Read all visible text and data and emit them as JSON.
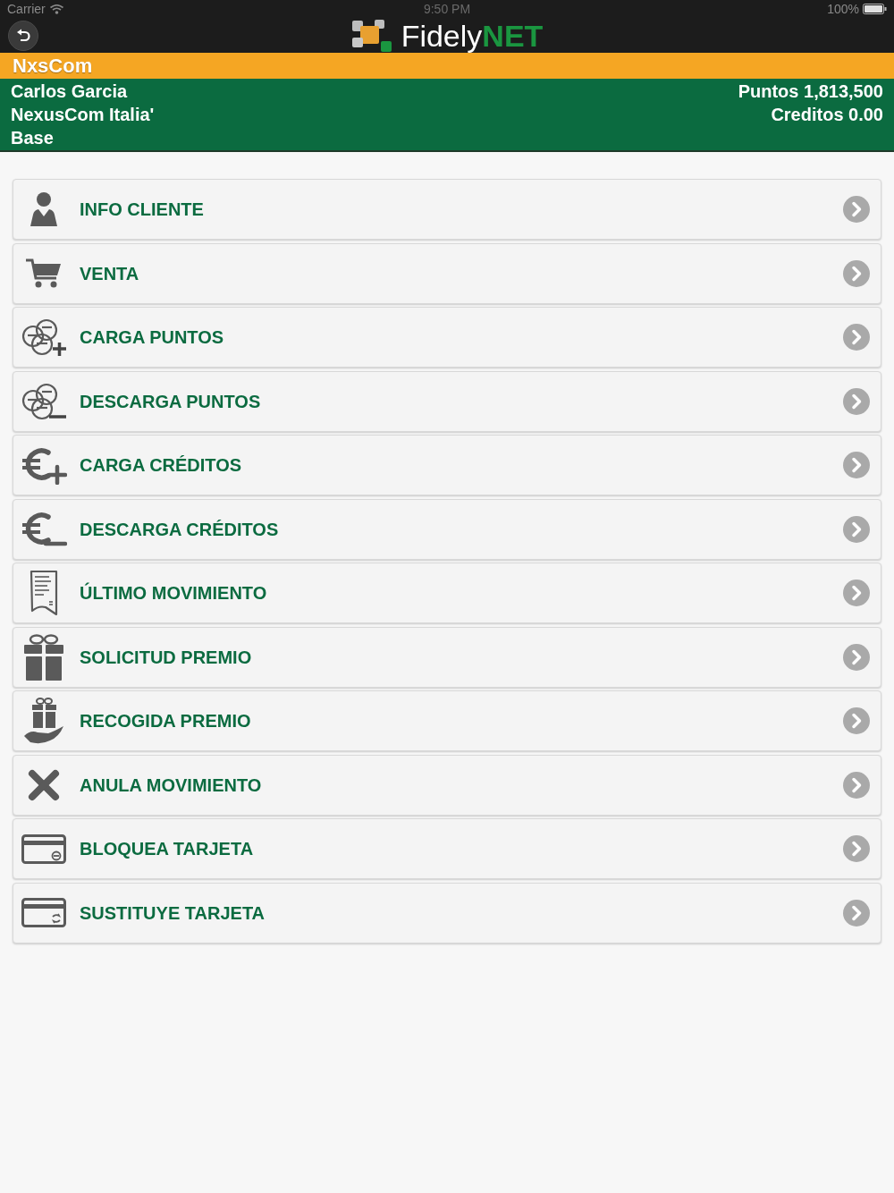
{
  "status_bar": {
    "carrier": "Carrier",
    "time": "9:50 PM",
    "battery": "100%"
  },
  "nav_bar": {
    "logo": "Fidely**NET**"
  },
  "store_bar": {
    "name": "NxsCom"
  },
  "customer": {
    "name": "Carlos Garcia",
    "company": "NexusCom Italia'",
    "tier": "Base",
    "points": "Puntos 1,813,500",
    "credits": "Creditos 0.00"
  },
  "menu": {
    "items": [
      {
        "label": "INFO CLIENTE"
      },
      {
        "label": "VENTA"
      },
      {
        "label": "CARGA PUNTOS"
      },
      {
        "label": "DESCARGA PUNTOS"
      },
      {
        "label": "CARGA CRÉDITOS"
      },
      {
        "label": "DESCARGA CRÉDITOS"
      },
      {
        "label": "ÚLTIMO MOVIMIENTO"
      },
      {
        "label": "SOLICITUD PREMIO"
      },
      {
        "label": "RECOGIDA PREMIO"
      },
      {
        "label": "ANULA MOVIMIENTO"
      },
      {
        "label": "BLOQUEA TARJETA"
      },
      {
        "label": "SUSTITUYE TARJETA"
      }
    ]
  }
}
